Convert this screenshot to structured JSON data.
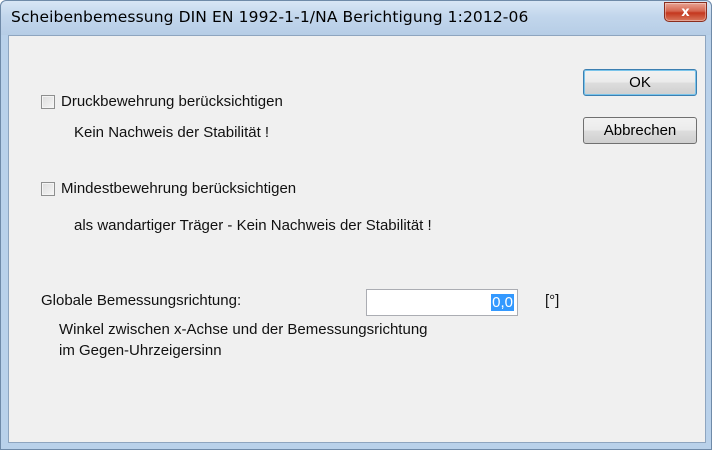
{
  "window": {
    "title": "Scheibenbemessung DIN EN 1992-1-1/NA Berichtigung 1:2012-06",
    "close_glyph": "x"
  },
  "options": {
    "druck": {
      "label": "Druckbewehrung berücksichtigen",
      "checked": false,
      "note": "Kein Nachweis der Stabilität !"
    },
    "mindest": {
      "label": "Mindestbewehrung berücksichtigen",
      "checked": false,
      "note": "als wandartiger Träger - Kein Nachweis der Stabilität !"
    }
  },
  "direction": {
    "label": "Globale Bemessungsrichtung:",
    "value": "0,0",
    "unit": "[°]",
    "help_line1": "Winkel zwischen x-Achse und der Bemessungsrichtung",
    "help_line2": "im Gegen-Uhrzeigersinn"
  },
  "buttons": {
    "ok": "OK",
    "cancel": "Abbrechen"
  },
  "icons": {
    "close": "close-icon",
    "checkbox": "checkbox-icon"
  }
}
